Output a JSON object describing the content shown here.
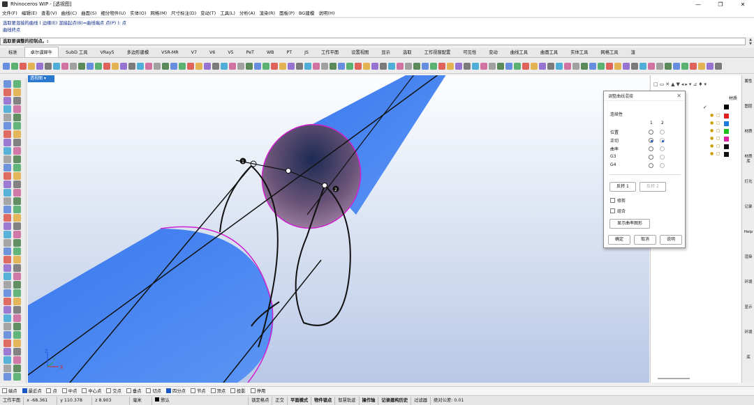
{
  "window": {
    "title": "Rhinoceros WIP - [透视图]",
    "min": "—",
    "max": "❐",
    "close": "✕"
  },
  "menu": [
    "文件(F)",
    "编辑(E)",
    "查看(V)",
    "曲线(C)",
    "曲面(S)",
    "细分物件(U)",
    "实体(O)",
    "网格(M)",
    "尺寸标注(D)",
    "变动(T)",
    "工具(L)",
    "分析(A)",
    "渲染(R)",
    "面板(P)",
    "BG建模",
    "说明(H)"
  ],
  "command_history": [
    "选取要混接的曲线 ( 边缘(E)  混接起点(B)=曲线端点  点(P) ): 点",
    "曲线终点"
  ],
  "command_prompt": "选取要调整的控制点。:",
  "tabs": [
    {
      "label": "标准",
      "active": false
    },
    {
      "label": "卓尔谟犀牛",
      "active": true
    },
    {
      "label": "SubD 工具",
      "active": false
    },
    {
      "label": "VRay5",
      "active": false
    },
    {
      "label": "多边形建模",
      "active": false
    },
    {
      "label": "VSR-MR",
      "active": false
    },
    {
      "label": "V7",
      "active": false
    },
    {
      "label": "V6",
      "active": false
    },
    {
      "label": "V5",
      "active": false
    },
    {
      "label": "PeT",
      "active": false
    },
    {
      "label": "WB",
      "active": false
    },
    {
      "label": "PT",
      "active": false
    },
    {
      "label": "JS",
      "active": false
    },
    {
      "label": "工作平面",
      "active": false
    },
    {
      "label": "设置视图",
      "active": false
    },
    {
      "label": "显示",
      "active": false
    },
    {
      "label": "选取",
      "active": false
    },
    {
      "label": "工作视窗配置",
      "active": false
    },
    {
      "label": "可见性",
      "active": false
    },
    {
      "label": "变动",
      "active": false
    },
    {
      "label": "曲线工具",
      "active": false
    },
    {
      "label": "曲面工具",
      "active": false
    },
    {
      "label": "实体工具",
      "active": false
    },
    {
      "label": "网格工具",
      "active": false
    },
    {
      "label": "渲",
      "active": false
    }
  ],
  "viewport": {
    "label": "透视图",
    "axes": {
      "x": "X",
      "y": "Y",
      "z": "Z"
    },
    "points": [
      "1",
      "2"
    ]
  },
  "dialog": {
    "title": "调整曲线混接",
    "continuity_label": "连续性",
    "col1": "1",
    "col2": "2",
    "rows": [
      {
        "label": "位置",
        "c1": false,
        "c2": false
      },
      {
        "label": "正切",
        "c1": true,
        "c2": true
      },
      {
        "label": "曲率",
        "c1": false,
        "c2": false
      },
      {
        "label": "G3",
        "c1": false,
        "c2": false
      },
      {
        "label": "G4",
        "c1": false,
        "c2": false
      }
    ],
    "reverse1": "反转 1",
    "reverse2": "反转 2",
    "trim": "修剪",
    "join": "组合",
    "show_curvature": "显示曲率图形",
    "ok": "确定",
    "cancel": "取消",
    "help": "说明"
  },
  "layers_panel": {
    "header": "材质"
  },
  "right_side_tabs": [
    "属性",
    "图层",
    "材质",
    "材质库",
    "灯光",
    "记录",
    "Help",
    "渲染",
    "环境",
    "显示",
    "环境",
    "底"
  ],
  "snaps": [
    {
      "label": "端点",
      "on": false
    },
    {
      "label": "最近点",
      "on": true
    },
    {
      "label": "点",
      "on": false
    },
    {
      "label": "中点",
      "on": false
    },
    {
      "label": "中心点",
      "on": false
    },
    {
      "label": "交点",
      "on": false
    },
    {
      "label": "垂点",
      "on": false
    },
    {
      "label": "切点",
      "on": false
    },
    {
      "label": "四分点",
      "on": true
    },
    {
      "label": "节点",
      "on": false
    },
    {
      "label": "顶点",
      "on": false
    },
    {
      "label": "投影",
      "on": false
    },
    {
      "label": "停用",
      "on": false
    }
  ],
  "status": {
    "cplane": "工作平面",
    "x": "x -68.361",
    "y": "y 110.378",
    "z": "z 8.903",
    "unit": "毫米",
    "layer": "默认",
    "grid_snap": "锁定格点",
    "ortho": "正交",
    "planar": "平面模式",
    "osnap": "物件锁点",
    "smarttrack": "智慧轨迹",
    "gumball": "操作轴",
    "history": "记录建构历史",
    "filter": "过滤器",
    "tolerance": "绝对公差: 0.01"
  },
  "colors": {
    "accent": "#1a56c4",
    "tube": "#4a86f0",
    "highlight": "#d020d0"
  }
}
